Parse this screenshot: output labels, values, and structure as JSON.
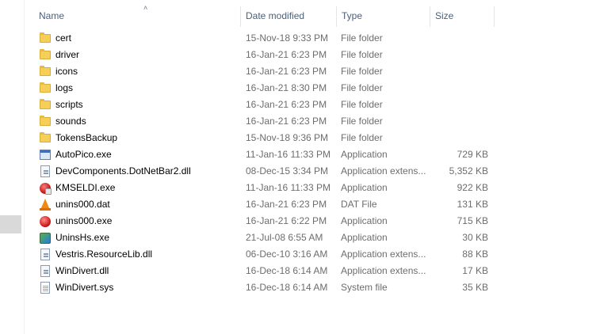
{
  "columns": {
    "name": "Name",
    "date_modified": "Date modified",
    "type": "Type",
    "size": "Size"
  },
  "sort": {
    "column": "name",
    "direction": "ascending",
    "icon": "chevron-up-icon"
  },
  "files": [
    {
      "name": "cert",
      "date": "15-Nov-18 9:33 PM",
      "type": "File folder",
      "size": "",
      "icon": "folder-icon"
    },
    {
      "name": "driver",
      "date": "16-Jan-21 6:23 PM",
      "type": "File folder",
      "size": "",
      "icon": "folder-icon"
    },
    {
      "name": "icons",
      "date": "16-Jan-21 6:23 PM",
      "type": "File folder",
      "size": "",
      "icon": "folder-icon"
    },
    {
      "name": "logs",
      "date": "16-Jan-21 8:30 PM",
      "type": "File folder",
      "size": "",
      "icon": "folder-icon"
    },
    {
      "name": "scripts",
      "date": "16-Jan-21 6:23 PM",
      "type": "File folder",
      "size": "",
      "icon": "folder-icon"
    },
    {
      "name": "sounds",
      "date": "16-Jan-21 6:23 PM",
      "type": "File folder",
      "size": "",
      "icon": "folder-icon"
    },
    {
      "name": "TokensBackup",
      "date": "15-Nov-18 9:36 PM",
      "type": "File folder",
      "size": "",
      "icon": "folder-icon"
    },
    {
      "name": "AutoPico.exe",
      "date": "11-Jan-16 11:33 PM",
      "type": "Application",
      "size": "729 KB",
      "icon": "application-icon"
    },
    {
      "name": "DevComponents.DotNetBar2.dll",
      "date": "08-Dec-15 3:34 PM",
      "type": "Application extens...",
      "size": "5,352 KB",
      "icon": "dll-icon"
    },
    {
      "name": "KMSELDI.exe",
      "date": "11-Jan-16 11:33 PM",
      "type": "Application",
      "size": "922 KB",
      "icon": "kms-app-icon"
    },
    {
      "name": "unins000.dat",
      "date": "16-Jan-21 6:23 PM",
      "type": "DAT File",
      "size": "131 KB",
      "icon": "vlc-file-icon"
    },
    {
      "name": "unins000.exe",
      "date": "16-Jan-21 6:22 PM",
      "type": "Application",
      "size": "715 KB",
      "icon": "uninstaller-icon"
    },
    {
      "name": "UninsHs.exe",
      "date": "21-Jul-08 6:55 AM",
      "type": "Application",
      "size": "30 KB",
      "icon": "uninshs-app-icon"
    },
    {
      "name": "Vestris.ResourceLib.dll",
      "date": "06-Dec-10 3:16 AM",
      "type": "Application extens...",
      "size": "88 KB",
      "icon": "dll-icon"
    },
    {
      "name": "WinDivert.dll",
      "date": "16-Dec-18 6:14 AM",
      "type": "Application extens...",
      "size": "17 KB",
      "icon": "dll-icon"
    },
    {
      "name": "WinDivert.sys",
      "date": "16-Dec-18 6:14 AM",
      "type": "System file",
      "size": "35 KB",
      "icon": "system-file-icon"
    }
  ]
}
